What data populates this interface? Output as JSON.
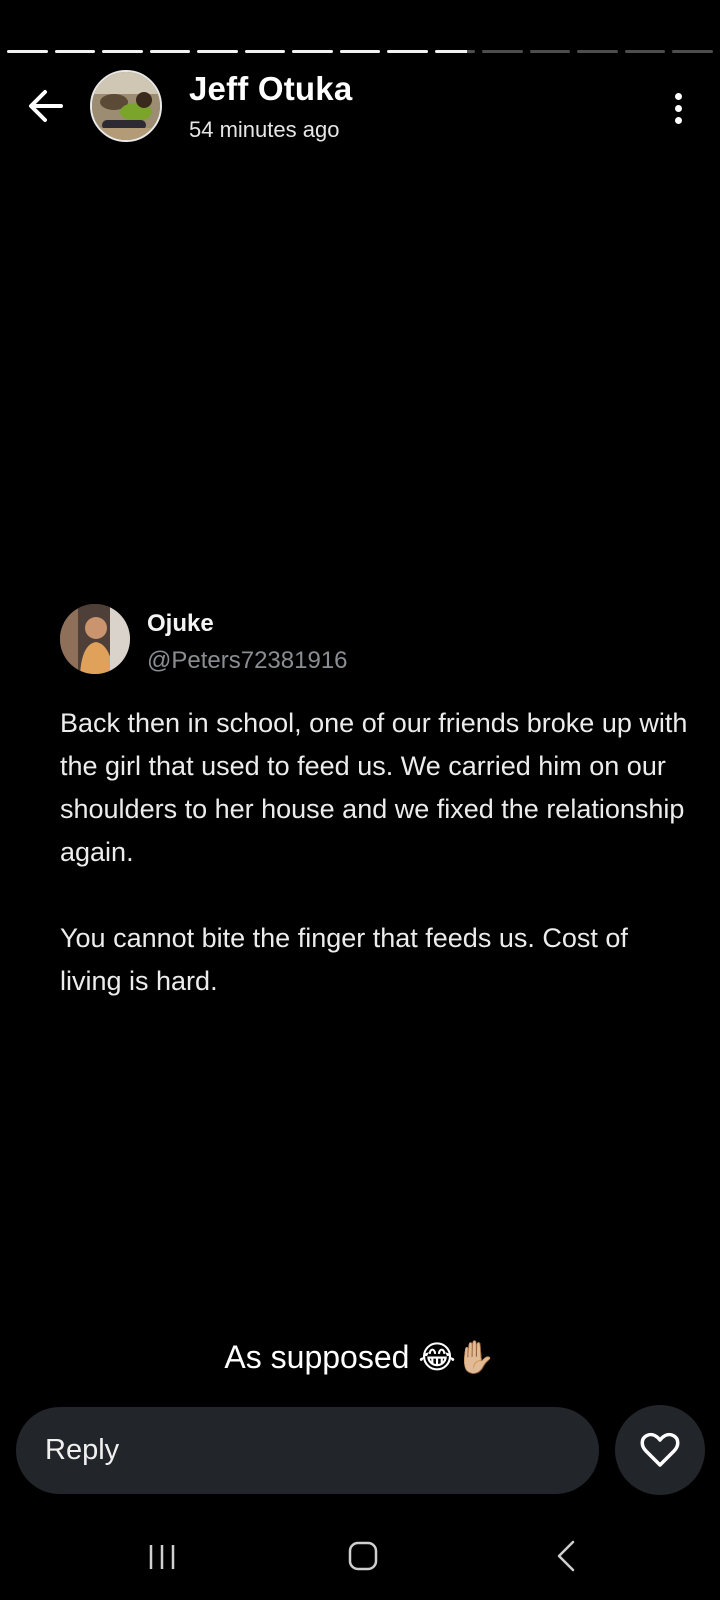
{
  "story": {
    "segments_total": 15,
    "segments_done": 9,
    "current_segment_progress": 0.8
  },
  "header": {
    "author_name": "Jeff Otuka",
    "time_ago": "54 minutes ago",
    "back_icon": "arrow-left-icon",
    "more_icon": "vertical-ellipsis-icon"
  },
  "tweet": {
    "name": "Ojuke",
    "handle": "@Peters72381916",
    "paragraph_1": "Back then in school, one of our friends broke up with the girl that used to feed us. We carried him on our shoulders to her house and we fixed the relationship again.",
    "paragraph_2": "You cannot bite the finger that feeds us. Cost of living is hard."
  },
  "caption": "As supposed 😂✋🏼",
  "reply": {
    "placeholder": "Reply",
    "like_icon": "heart-icon"
  },
  "system_nav": {
    "recent_icon": "recent-apps-icon",
    "home_icon": "home-icon",
    "back_icon": "back-chevron-icon"
  },
  "colors": {
    "background": "#000000",
    "reply_bar": "#22262a",
    "handle_gray": "#8a8d91",
    "progress_active": "#f2f2f2",
    "progress_inactive": "#4d4d4d"
  }
}
